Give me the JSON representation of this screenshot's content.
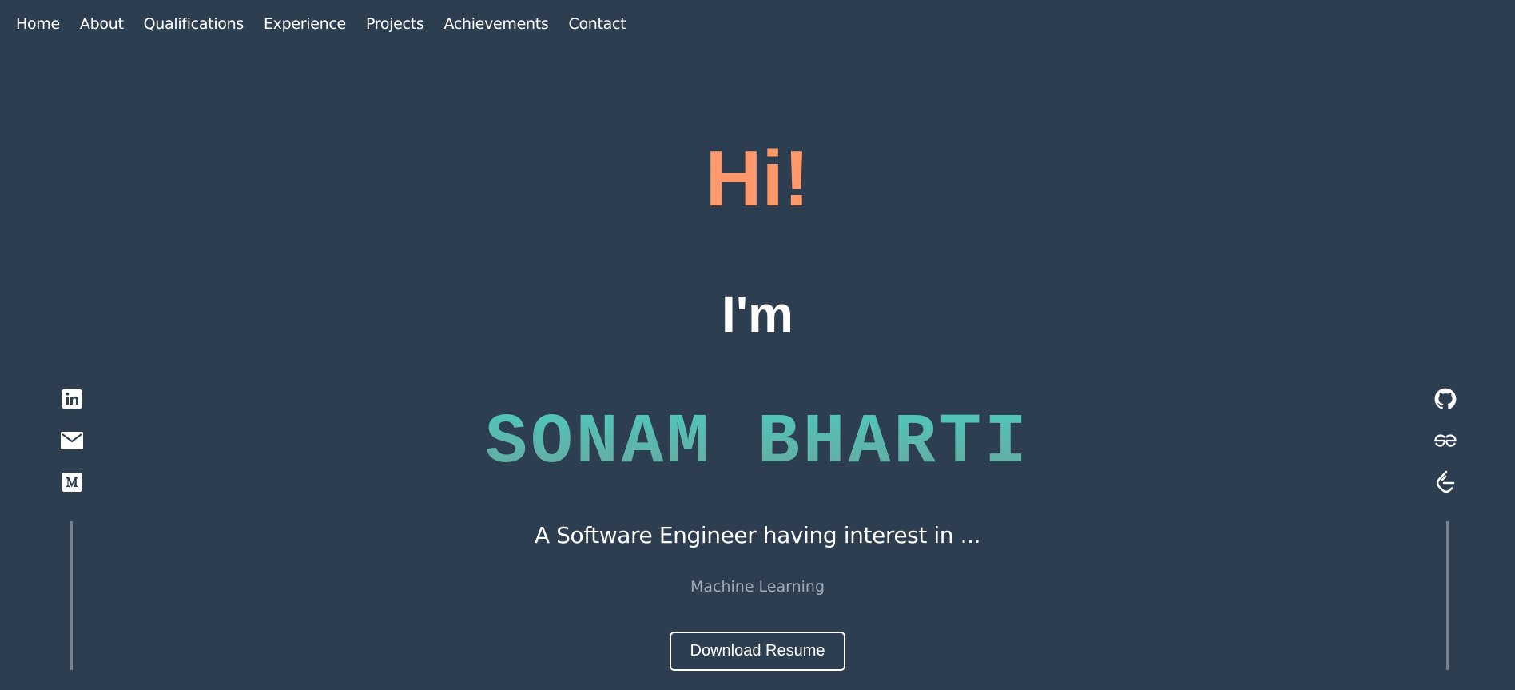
{
  "nav": {
    "items": [
      "Home",
      "About",
      "Qualifications",
      "Experience",
      "Projects",
      "Achievements",
      "Contact"
    ]
  },
  "hero": {
    "greeting": "Hi!",
    "intro": "I'm",
    "name": "SONAM BHARTI",
    "tagline": "A Software Engineer having interest in ...",
    "interest": "Machine Learning",
    "resume_button": "Download Resume"
  },
  "social_left": [
    "linkedin-icon",
    "mail-icon",
    "medium-icon"
  ],
  "social_right": [
    "github-icon",
    "geeksforgeeks-icon",
    "leetcode-icon"
  ],
  "colors": {
    "background": "#2e3e51",
    "greeting": "#ff996b",
    "name_gradient_top": "#4ec9bd",
    "name_gradient_bottom": "#6aa59c",
    "muted_text": "#a2acb8",
    "divider": "#76818d"
  }
}
